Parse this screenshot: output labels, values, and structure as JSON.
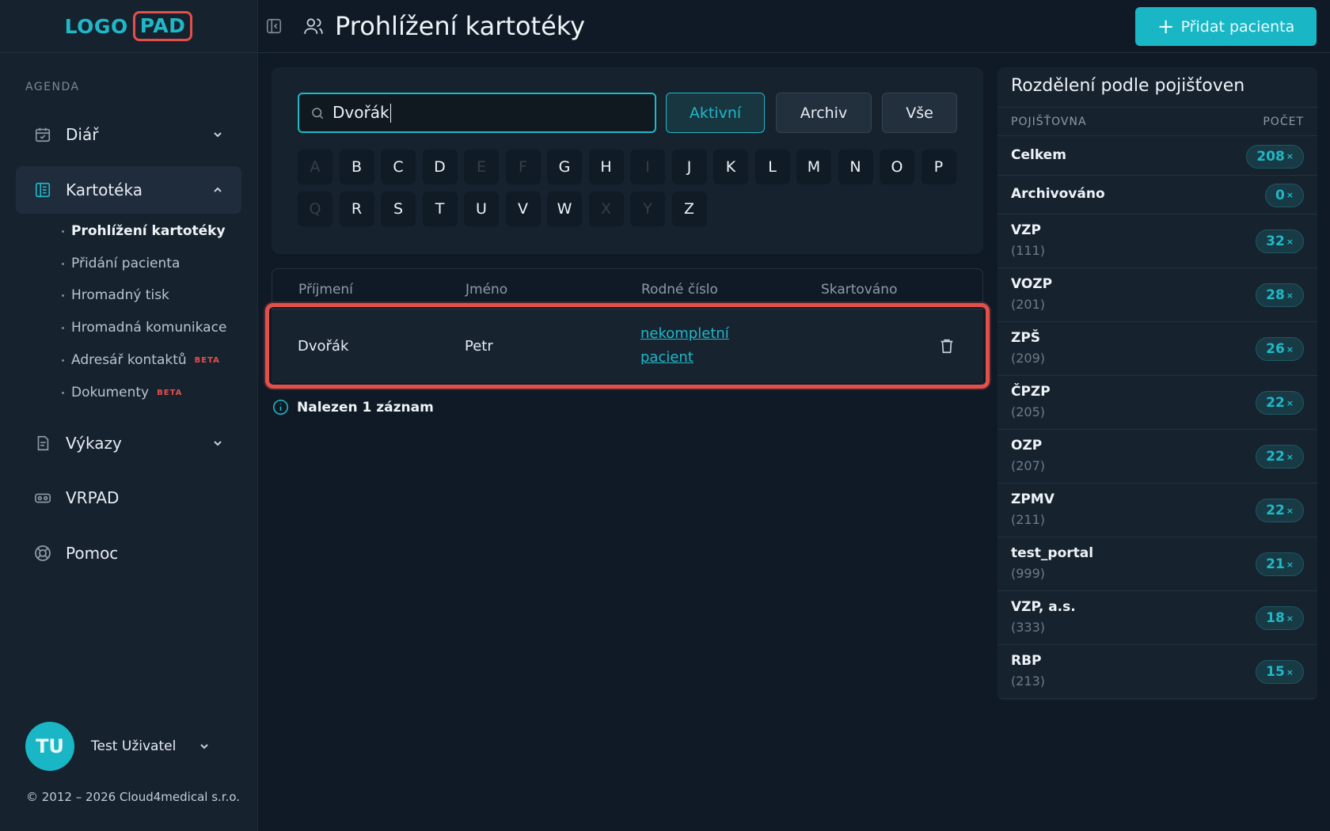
{
  "logo": {
    "left": "LOGO",
    "right": "PAD"
  },
  "sidebar": {
    "section": "AGENDA",
    "items": [
      {
        "label": "Diář",
        "icon": "calendar-icon",
        "expanded": false
      },
      {
        "label": "Kartotéka",
        "icon": "file-cabinet-icon",
        "expanded": true
      },
      {
        "label": "Výkazy",
        "icon": "report-icon",
        "expanded": false
      },
      {
        "label": "VRPAD",
        "icon": "vr-headset-icon"
      },
      {
        "label": "Pomoc",
        "icon": "lifebuoy-icon"
      }
    ],
    "subitems": [
      {
        "label": "Prohlížení kartotéky",
        "current": true
      },
      {
        "label": "Přidání pacienta"
      },
      {
        "label": "Hromadný tisk"
      },
      {
        "label": "Hromadná komunikace"
      },
      {
        "label": "Adresář kontaktů",
        "badge": "BETA"
      },
      {
        "label": "Dokumenty",
        "badge": "BETA"
      }
    ]
  },
  "user": {
    "initials": "TU",
    "name": "Test Uživatel"
  },
  "footer": {
    "copyright": "© 2012 – 2026 Cloud4medical s.r.o."
  },
  "header": {
    "title": "Prohlížení kartotéky",
    "add_button": "Přidat pacienta"
  },
  "search": {
    "value": "Dvořák",
    "filters": [
      {
        "label": "Aktivní",
        "active": true
      },
      {
        "label": "Archiv",
        "active": false
      },
      {
        "label": "Vše",
        "active": false
      }
    ],
    "letters_row1": [
      "A",
      "B",
      "C",
      "D",
      "E",
      "F",
      "G",
      "H",
      "I",
      "J",
      "K",
      "L",
      "M",
      "N",
      "O",
      "P"
    ],
    "letters_row2": [
      "Q",
      "R",
      "S",
      "T",
      "U",
      "V",
      "W",
      "X",
      "Y",
      "Z"
    ],
    "disabled_letters": [
      "A",
      "E",
      "F",
      "I",
      "Q",
      "X",
      "Y"
    ]
  },
  "table": {
    "columns": [
      "Příjmení",
      "Jméno",
      "Rodné číslo",
      "Skartováno"
    ],
    "rows": [
      {
        "surname": "Dvořák",
        "name": "Petr",
        "birth_number_line1": "nekompletní",
        "birth_number_line2": "pacient",
        "shredded": ""
      }
    ],
    "result_text": "Nalezen 1 záznam"
  },
  "insurance": {
    "title": "Rozdělení podle pojišťoven",
    "col_left": "POJIŠŤOVNA",
    "col_right": "POČET",
    "rows": [
      {
        "name": "Celkem",
        "code": "",
        "count": "208"
      },
      {
        "name": "Archivováno",
        "code": "",
        "count": "0"
      },
      {
        "name": "VZP",
        "code": "(111)",
        "count": "32"
      },
      {
        "name": "VOZP",
        "code": "(201)",
        "count": "28"
      },
      {
        "name": "ZPŠ",
        "code": "(209)",
        "count": "26"
      },
      {
        "name": "ČPZP",
        "code": "(205)",
        "count": "22"
      },
      {
        "name": "OZP",
        "code": "(207)",
        "count": "22"
      },
      {
        "name": "ZPMV",
        "code": "(211)",
        "count": "22"
      },
      {
        "name": "test_portal",
        "code": "(999)",
        "count": "21"
      },
      {
        "name": "VZP, a.s.",
        "code": "(333)",
        "count": "18"
      },
      {
        "name": "RBP",
        "code": "(213)",
        "count": "15"
      }
    ],
    "count_suffix": "×"
  },
  "colors": {
    "accent": "#1fb8c8",
    "highlight": "#e2504a",
    "background": "#0f1a26",
    "panel": "#17222f"
  }
}
